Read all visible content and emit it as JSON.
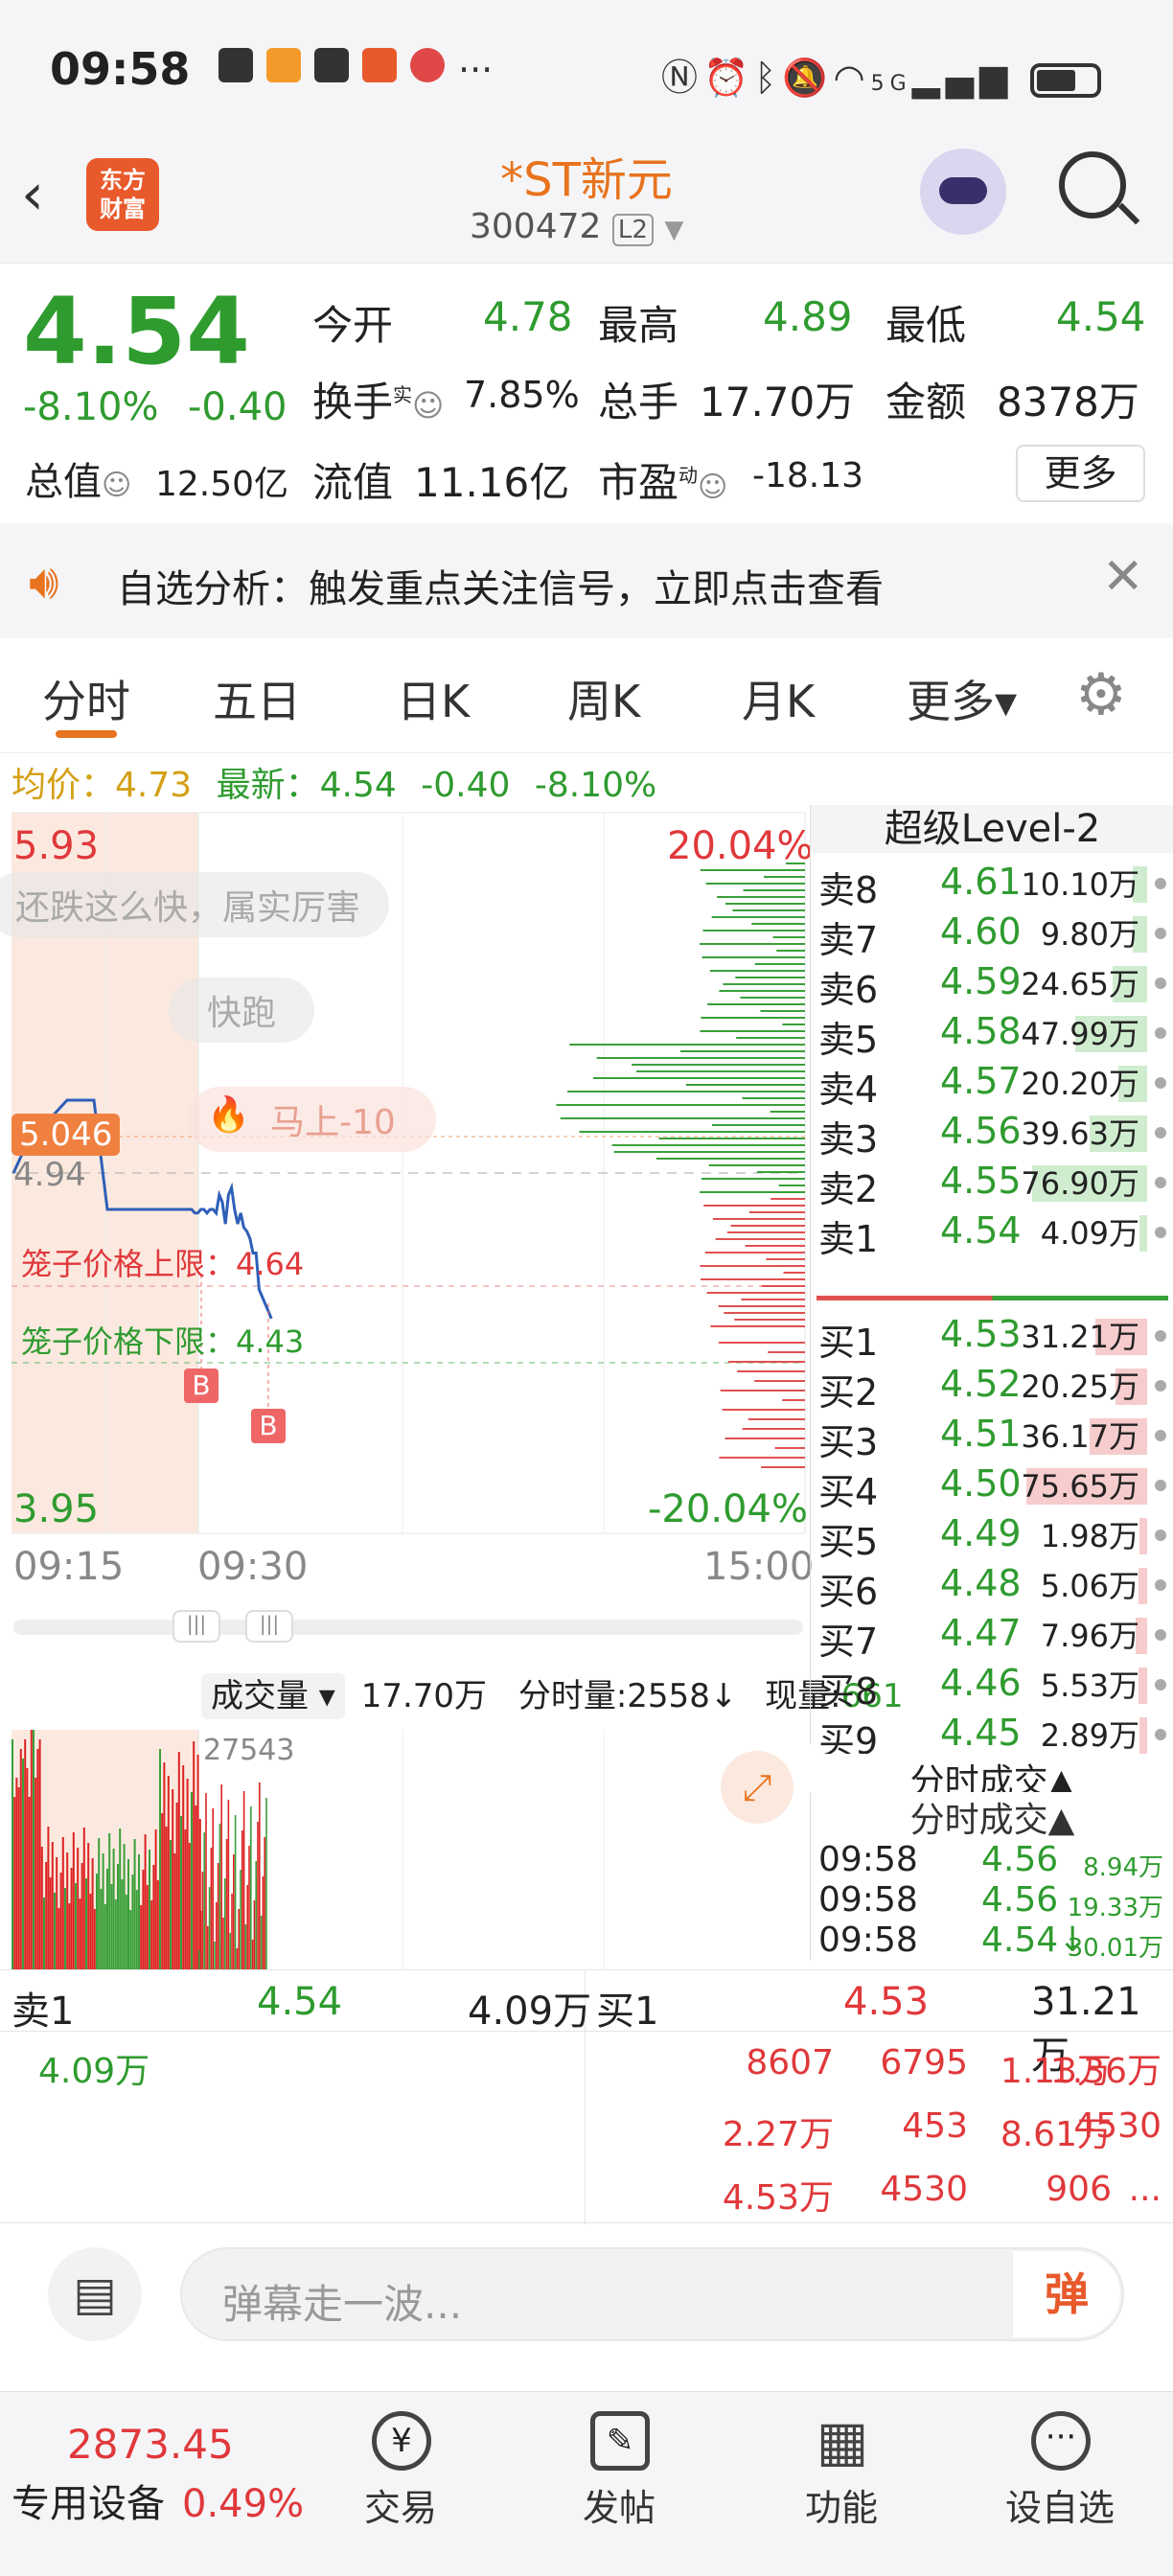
{
  "status": {
    "time": "09:58",
    "net": "5G"
  },
  "header": {
    "brand": "东方\n财富",
    "title": "*ST新元",
    "code": "300472",
    "level": "L2"
  },
  "quote": {
    "price": "4.54",
    "pct": "-8.10%",
    "chg": "-0.40",
    "open_l": "今开",
    "open": "4.78",
    "high_l": "最高",
    "high": "4.89",
    "low_l": "最低",
    "low": "4.54",
    "turn_l": "换手",
    "turn_sup": "实",
    "turn": "7.85%",
    "vol_l": "总手",
    "vol": "17.70万",
    "amt_l": "金额",
    "amt": "8378万",
    "mcap_l": "总值",
    "mcap": "12.50亿",
    "fcap_l": "流值",
    "fcap": "11.16亿",
    "pe_l": "市盈",
    "pe_sup": "动",
    "pe": "-18.13",
    "more": "更多"
  },
  "notice": {
    "text": "自选分析：触发重点关注信号，立即点击查看"
  },
  "tabs": [
    "分时",
    "五日",
    "日K",
    "周K",
    "月K",
    "更多▾"
  ],
  "chart_info": {
    "avg_l": "均价：",
    "avg": "4.73",
    "last_l": "最新：",
    "last": "4.54",
    "chg": "-0.40",
    "pct": "-8.10%"
  },
  "chart_data": {
    "type": "line",
    "ymax": "5.93",
    "ymin": "3.95",
    "pmax": "20.04%",
    "pmin": "-20.04%",
    "xticks": [
      "09:15",
      "09:30",
      "15:00"
    ],
    "ref_price": "4.94",
    "marker_price": "5.046",
    "cage_upper": "笼子价格上限：4.64",
    "cage_lower": "笼子价格下限：4.43",
    "comments": [
      "还跌这么快，属实厉害",
      "快跑",
      "马上-10"
    ],
    "buy_marker": "B",
    "ylim": [
      3.95,
      5.93
    ],
    "preauction": [
      4.94,
      5.02,
      5.02,
      5.1,
      5.14,
      5.14,
      5.14,
      4.84,
      4.84,
      4.84,
      4.84,
      4.84,
      4.84,
      4.84
    ],
    "series": [
      4.84,
      4.83,
      4.83,
      4.84,
      4.84,
      4.83,
      4.84,
      4.84,
      4.83,
      4.88,
      4.86,
      4.8,
      4.88,
      4.9,
      4.84,
      4.8,
      4.83,
      4.79,
      4.78,
      4.76,
      4.72,
      4.72,
      4.62,
      4.6,
      4.58,
      4.56,
      4.54
    ]
  },
  "volume": {
    "label": "成交量",
    "total": "17.70万",
    "period_l": "分时量:2558↓",
    "now_l": "现量:",
    "now": "661",
    "max": "27543"
  },
  "level2": {
    "title": "超级Level-2",
    "sell": [
      [
        "卖8",
        "4.61",
        "10.10万",
        0.05
      ],
      [
        "卖7",
        "4.60",
        "9.80万",
        0.05
      ],
      [
        "卖6",
        "4.59",
        "24.65万",
        0.12
      ],
      [
        "卖5",
        "4.58",
        "47.99万",
        0.25
      ],
      [
        "卖4",
        "4.57",
        "20.20万",
        0.1
      ],
      [
        "卖3",
        "4.56",
        "39.63万",
        0.2
      ],
      [
        "卖2",
        "4.55",
        "76.90万",
        0.4
      ],
      [
        "卖1",
        "4.54",
        "4.09万",
        0.02
      ]
    ],
    "buy": [
      [
        "买1",
        "4.53",
        "31.21万",
        0.18
      ],
      [
        "买2",
        "4.52",
        "20.25万",
        0.11
      ],
      [
        "买3",
        "4.51",
        "36.17万",
        0.2
      ],
      [
        "买4",
        "4.50",
        "75.65万",
        0.42
      ],
      [
        "买5",
        "4.49",
        "1.98万",
        0.01
      ],
      [
        "买6",
        "4.48",
        "5.06万",
        0.03
      ],
      [
        "买7",
        "4.47",
        "7.96万",
        0.04
      ],
      [
        "买8",
        "4.46",
        "5.53万",
        0.03
      ],
      [
        "买9",
        "4.45",
        "2.89万",
        0.02
      ]
    ],
    "trades_title": "分时成交▲",
    "trades": [
      [
        "09:58",
        "4.56",
        "8.94万"
      ],
      [
        "09:58",
        "4.56",
        "19.33万"
      ],
      [
        "09:58",
        "4.54↓",
        "30.01万"
      ]
    ]
  },
  "queue": {
    "sell_l": "卖1",
    "sell_p": "4.54",
    "sell_v": "4.09万",
    "sell_items": [
      "4.09万"
    ],
    "buy_l": "买1",
    "buy_p": "4.53",
    "buy_v": "31.21万",
    "buy_items": [
      "8607",
      "6795",
      "1.13万",
      "1.36万",
      "2.27万",
      "453",
      "8.61万",
      "4530",
      "4.53万",
      "4530",
      "906",
      "..."
    ]
  },
  "comment_bar": {
    "placeholder": "弹幕走一波...",
    "btn": "弹"
  },
  "bottom": {
    "index": "2873.45",
    "device": "专用设备",
    "device_pct": "0.49%",
    "items": [
      "交易",
      "发帖",
      "功能",
      "设自选"
    ]
  }
}
